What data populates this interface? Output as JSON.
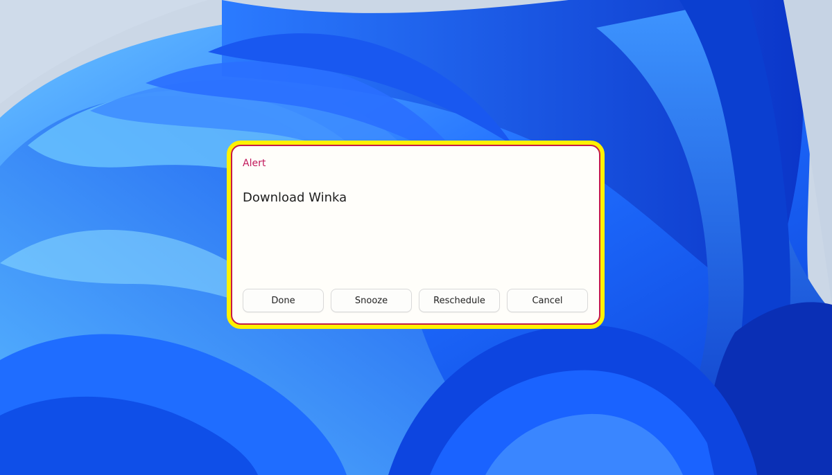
{
  "wallpaper": {
    "name": "bloom-wallpaper",
    "colors": {
      "sky": "#c9d6e6",
      "deep_blue": "#0a3fd6",
      "mid_blue": "#1f6dff",
      "light_blue": "#4fb0ff",
      "highlight": "#7fd3ff"
    }
  },
  "dialog": {
    "title": "Alert",
    "message": "Download Winka",
    "highlight_border_color": "#fff200",
    "border_color": "#c41a4a",
    "title_color": "#c2185b",
    "buttons": [
      {
        "label": "Done"
      },
      {
        "label": "Snooze"
      },
      {
        "label": "Reschedule"
      },
      {
        "label": "Cancel"
      }
    ]
  }
}
